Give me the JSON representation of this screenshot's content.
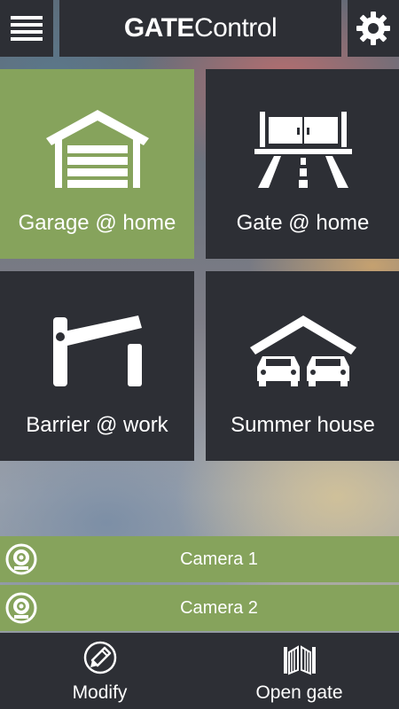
{
  "app": {
    "title_bold": "GATE",
    "title_regular": "Control",
    "menu_icon": "hamburger-menu-icon",
    "settings_icon": "gear-icon"
  },
  "tiles": [
    {
      "label": "Garage @ home",
      "icon": "garage-icon",
      "selected": true
    },
    {
      "label": "Gate @ home",
      "icon": "gate-road-icon",
      "selected": false
    },
    {
      "label": "Barrier @ work",
      "icon": "barrier-icon",
      "selected": false
    },
    {
      "label": "Summer house",
      "icon": "carport-icon",
      "selected": false
    }
  ],
  "cameras": [
    {
      "label": "Camera 1",
      "icon": "webcam-icon"
    },
    {
      "label": "Camera 2",
      "icon": "webcam-icon"
    }
  ],
  "bottom_bar": {
    "modify_label": "Modify",
    "modify_icon": "pencil-icon",
    "open_label": "Open gate",
    "open_icon": "gate-open-icon"
  },
  "colors": {
    "accent_green": "#86a35c",
    "dark_panel": "#2d2f35",
    "text": "#ffffff"
  }
}
